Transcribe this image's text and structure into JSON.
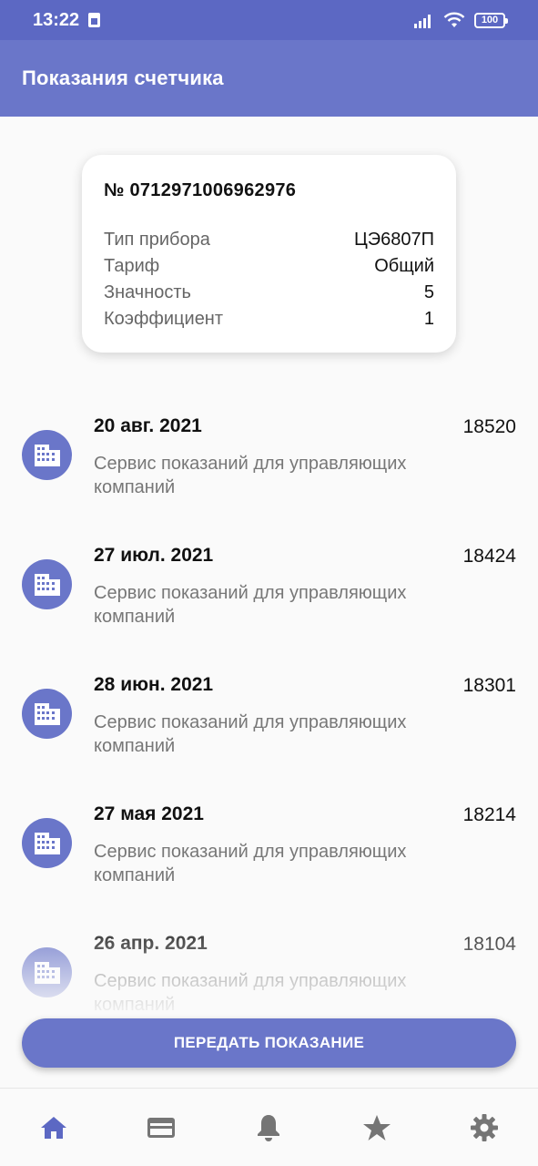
{
  "status_bar": {
    "time": "13:22",
    "battery": "100"
  },
  "app_bar": {
    "title": "Показания счетчика"
  },
  "meter": {
    "number": "№ 0712971006962976",
    "rows": [
      {
        "label": "Тип прибора",
        "value": "ЦЭ6807П"
      },
      {
        "label": "Тариф",
        "value": "Общий"
      },
      {
        "label": "Значность",
        "value": "5"
      },
      {
        "label": "Коэффициент",
        "value": "1"
      }
    ]
  },
  "readings": [
    {
      "date": "20 авг. 2021",
      "value": "18520",
      "source": "Сервис показаний для управляющих компаний",
      "icon": "building-icon"
    },
    {
      "date": "27 июл. 2021",
      "value": "18424",
      "source": "Сервис показаний для управляющих компаний",
      "icon": "building-icon"
    },
    {
      "date": "28 июн. 2021",
      "value": "18301",
      "source": "Сервис показаний для управляющих компаний",
      "icon": "building-icon"
    },
    {
      "date": "27 мая 2021",
      "value": "18214",
      "source": "Сервис показаний для управляющих компаний",
      "icon": "building-icon"
    },
    {
      "date": "26 апр. 2021",
      "value": "18104",
      "source": "Сервис показаний для управляющих компаний",
      "icon": "building-icon"
    }
  ],
  "submit_button": {
    "label": "ПЕРЕДАТЬ ПОКАЗАНИЕ"
  },
  "bottom_nav": {
    "items": [
      {
        "icon": "home-icon",
        "active": true
      },
      {
        "icon": "card-icon",
        "active": false
      },
      {
        "icon": "bell-icon",
        "active": false
      },
      {
        "icon": "star-icon",
        "active": false
      },
      {
        "icon": "gear-icon",
        "active": false
      }
    ]
  },
  "colors": {
    "primary": "#6a76c9",
    "status_bar": "#5c68c3",
    "active_nav": "#5c68c3",
    "inactive_nav": "#757575"
  }
}
